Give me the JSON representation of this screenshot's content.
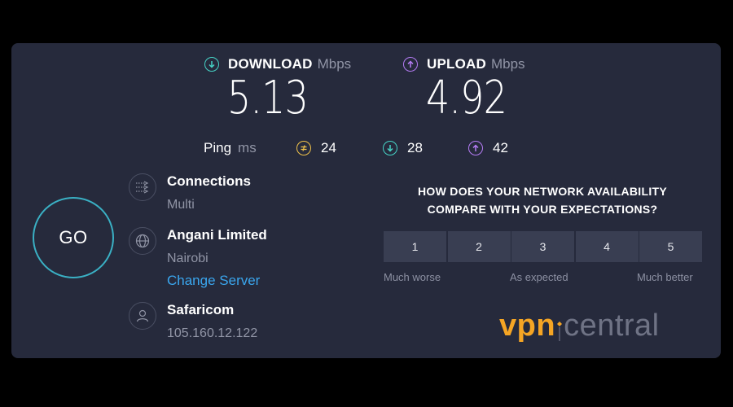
{
  "download": {
    "label": "DOWNLOAD",
    "unit": "Mbps",
    "value": "5.13",
    "icon": "arrow-down-circle-icon",
    "color": "#46d3c6"
  },
  "upload": {
    "label": "UPLOAD",
    "unit": "Mbps",
    "value": "4.92",
    "icon": "arrow-up-circle-icon",
    "color": "#b57cf5"
  },
  "ping": {
    "label": "Ping",
    "unit": "ms",
    "idle": "24",
    "download": "28",
    "upload": "42",
    "idle_color": "#f0c24a"
  },
  "go_label": "GO",
  "connections": {
    "title": "Connections",
    "value": "Multi"
  },
  "server": {
    "title": "Angani Limited",
    "location": "Nairobi",
    "change_link": "Change Server"
  },
  "provider": {
    "title": "Safaricom",
    "ip": "105.160.12.122"
  },
  "survey": {
    "question_line1": "HOW DOES YOUR NETWORK AVAILABILITY",
    "question_line2": "COMPARE WITH YOUR EXPECTATIONS?",
    "options": [
      "1",
      "2",
      "3",
      "4",
      "5"
    ],
    "low_label": "Much worse",
    "mid_label": "As expected",
    "high_label": "Much better"
  },
  "watermark": {
    "part1": "vpn",
    "part2": "central"
  }
}
